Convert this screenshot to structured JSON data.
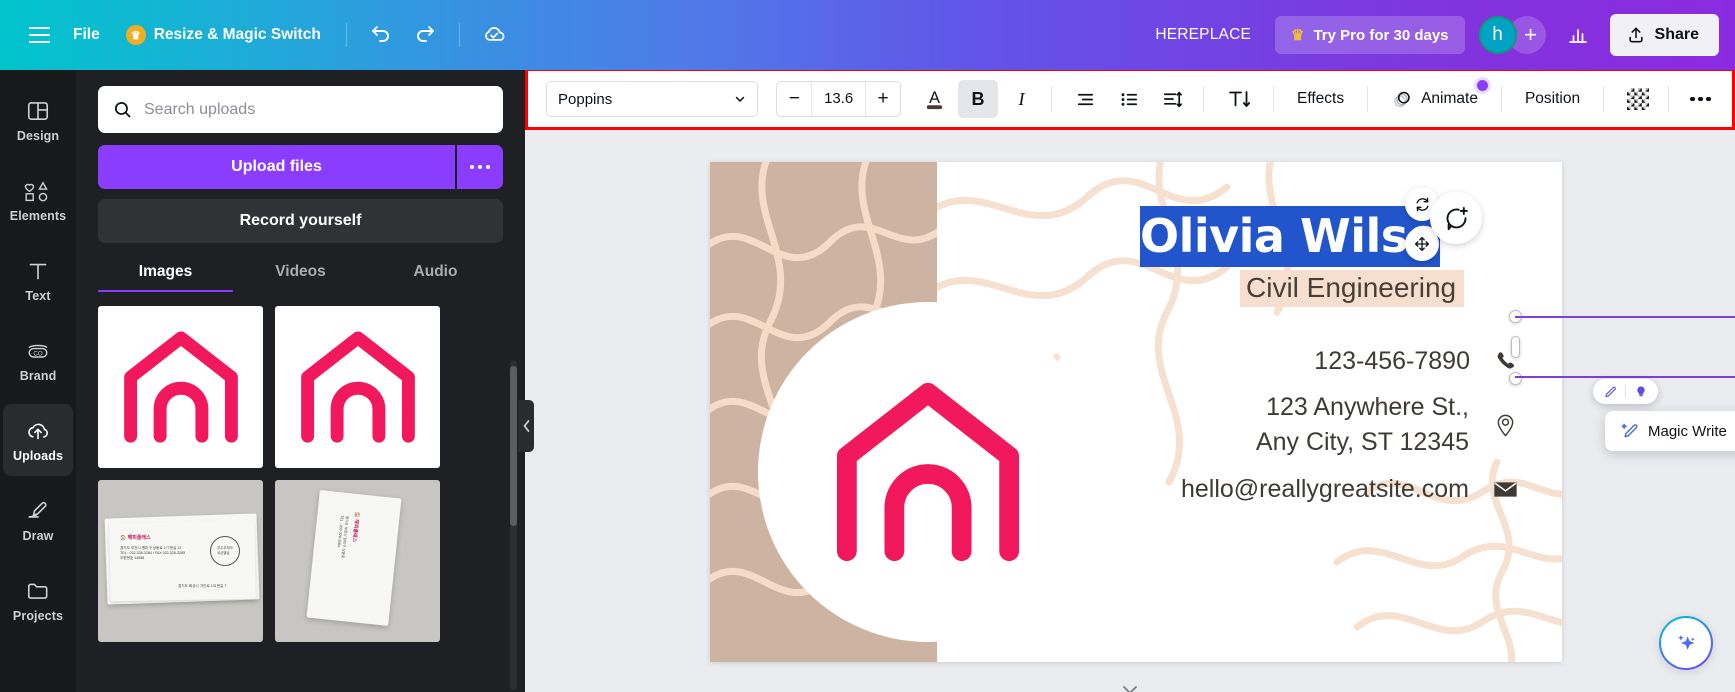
{
  "topbar": {
    "menu_icon": "hamburger-icon",
    "file_label": "File",
    "resize_label": "Resize & Magic Switch",
    "undo_icon": "undo-icon",
    "redo_icon": "redo-icon",
    "cloud_icon": "cloud-saved-icon",
    "doc_title": "HEREPLACE",
    "try_pro_label": "Try Pro for 30 days",
    "avatar_initial": "h",
    "add_people_icon": "plus-icon",
    "insights_icon": "bar-chart-icon",
    "share_label": "Share",
    "share_icon": "upload-icon"
  },
  "toolbar": {
    "font_name": "Poppins",
    "font_size": "13.6",
    "minus_label": "−",
    "plus_label": "+",
    "text_color_icon": "text-color-icon",
    "bold_label": "B",
    "italic_label": "I",
    "align_icon": "text-align-icon",
    "list_icon": "bullet-list-icon",
    "spacing_icon": "line-spacing-icon",
    "text_direction_icon": "text-direction-icon",
    "effects_label": "Effects",
    "animate_label": "Animate",
    "animate_icon": "animate-icon",
    "position_label": "Position",
    "transparency_icon": "transparency-icon",
    "more_icon": "more-options-icon"
  },
  "sidebar": {
    "items": [
      {
        "label": "Design",
        "icon": "design-icon",
        "active": false
      },
      {
        "label": "Elements",
        "icon": "elements-icon",
        "active": false
      },
      {
        "label": "Text",
        "icon": "text-icon",
        "active": false
      },
      {
        "label": "Brand",
        "icon": "brand-icon",
        "active": false
      },
      {
        "label": "Uploads",
        "icon": "uploads-icon",
        "active": true
      },
      {
        "label": "Draw",
        "icon": "draw-icon",
        "active": false
      },
      {
        "label": "Projects",
        "icon": "projects-icon",
        "active": false
      }
    ]
  },
  "uploads_panel": {
    "search_placeholder": "Search uploads",
    "search_value": "",
    "search_icon": "search-icon",
    "upload_files_label": "Upload files",
    "upload_more_icon": "more-options-icon",
    "record_label": "Record yourself",
    "tabs": [
      {
        "label": "Images",
        "active": true
      },
      {
        "label": "Videos",
        "active": false
      },
      {
        "label": "Audio",
        "active": false
      }
    ],
    "thumbnails": [
      {
        "name": "house-logo-thumbnail-1",
        "type": "logo"
      },
      {
        "name": "house-logo-thumbnail-2",
        "type": "logo"
      },
      {
        "name": "envelope-photo-thumbnail-1",
        "type": "photo"
      },
      {
        "name": "envelope-photo-thumbnail-2",
        "type": "photo"
      }
    ],
    "collapse_icon": "chevron-left-icon"
  },
  "canvas": {
    "card": {
      "name_text": "Olivia Wilson",
      "role_text": "Civil Engineering",
      "phone_text": "123-456-7890",
      "address_line1": "123 Anywhere St.,",
      "address_line2": "Any City, ST 12345",
      "email_text": "hello@reallygreatsite.com",
      "phone_icon": "phone-icon",
      "location_icon": "location-pin-icon",
      "email_icon": "envelope-icon",
      "logo_icon": "house-logo-icon"
    },
    "selection": {
      "edit_icon": "edit-pencil-icon",
      "idea_icon": "lightbulb-icon",
      "magic_write_label": "Magic Write",
      "magic_write_icon": "magic-wand-pencil-icon",
      "link_icon": "link-icon",
      "rotate_icon": "rotate-icon",
      "move_icon": "move-icon",
      "comment_icon": "add-comment-icon"
    },
    "ai_assistant_icon": "sparkles-icon",
    "next_page_icon": "chevron-down-icon"
  },
  "colors": {
    "brand_purple": "#8b3dff",
    "logo_pink": "#f2185e",
    "card_beige": "#cdb3a1",
    "card_peach": "#f6dfce",
    "selection_blue": "#2255cc",
    "selection_purple": "#7d3fe0",
    "highlight_red": "#ff0000"
  }
}
